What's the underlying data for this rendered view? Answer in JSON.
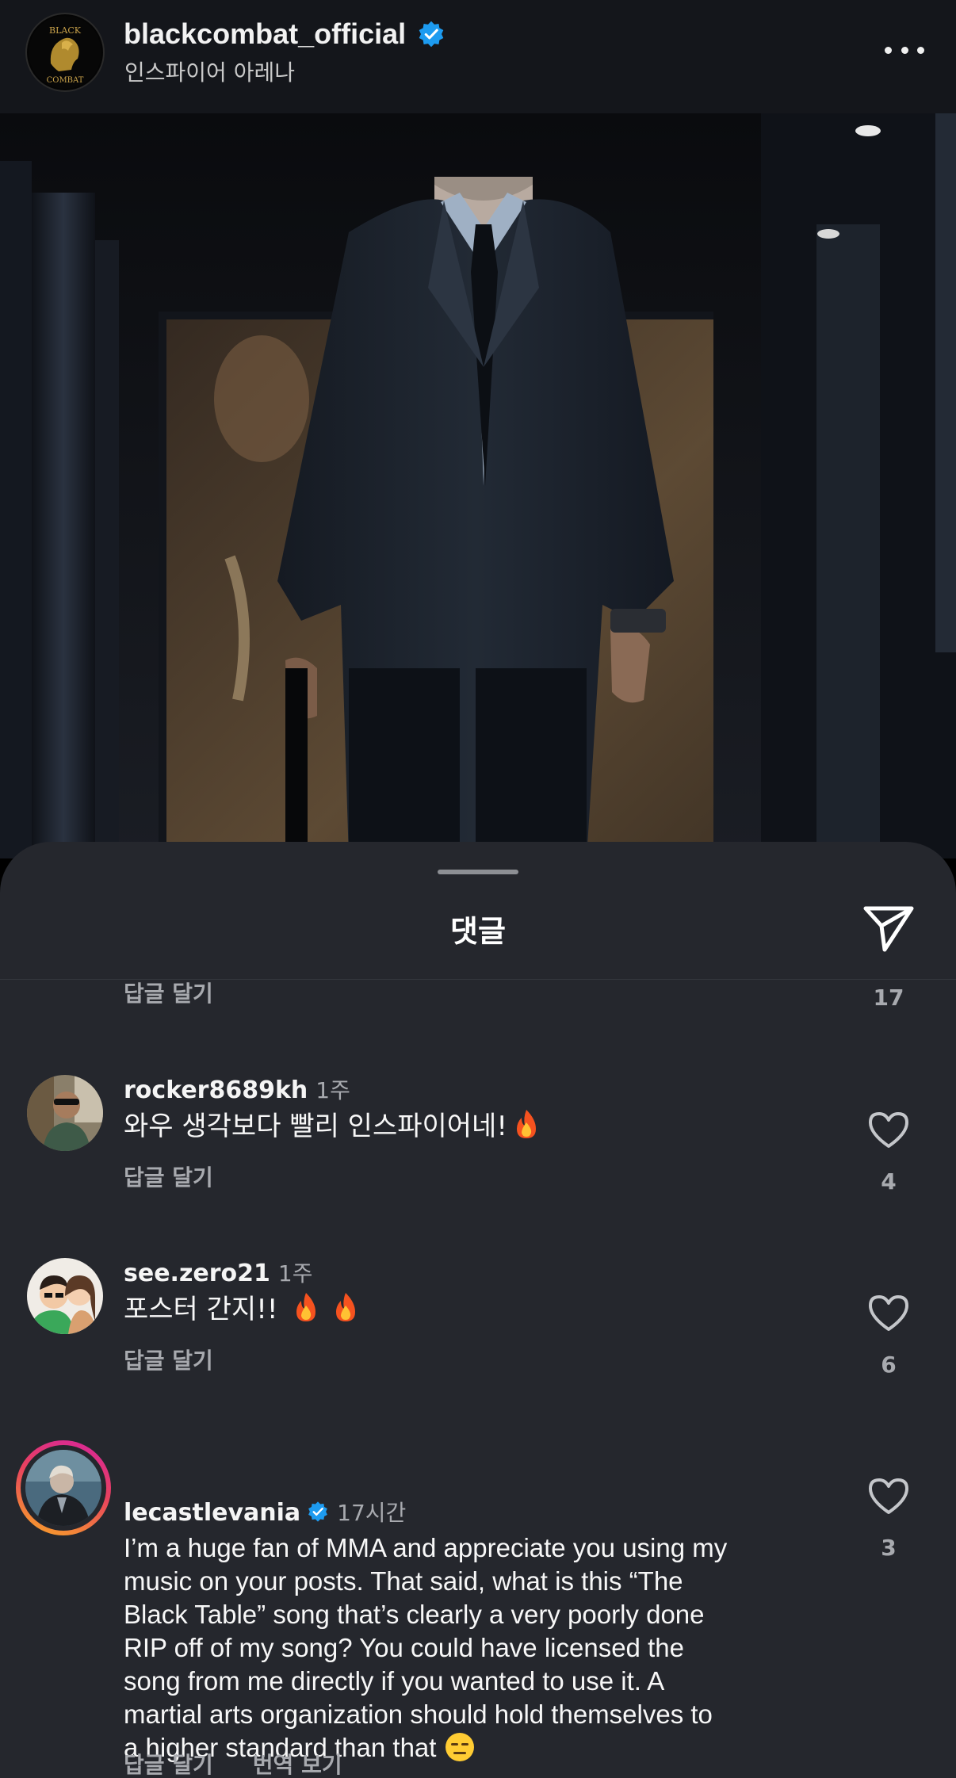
{
  "post": {
    "username": "blackcombat_official",
    "verified": true,
    "location": "인스파이어 아레나",
    "logo_text": [
      "BLACK",
      "COMBAT"
    ],
    "more_icon": "more-horizontal-icon"
  },
  "sheet": {
    "title": "댓글",
    "share_icon": "send-icon"
  },
  "previous_comment": {
    "reply_label": "답글 달기",
    "likes": "17"
  },
  "comments": [
    {
      "username": "rocker8689kh",
      "time": "1주",
      "text": "와우 생각보다 빨리 인스파이어네!",
      "emoji": [
        "fire"
      ],
      "reply_label": "답글 달기",
      "likes": "4"
    },
    {
      "username": "see.zero21",
      "time": "1주",
      "text": "포스터 간지!!",
      "emoji": [
        "fire",
        "fire"
      ],
      "reply_label": "답글 달기",
      "likes": "6"
    },
    {
      "username": "lecastlevania",
      "verified": true,
      "time": "17시간",
      "has_story_ring": true,
      "text_lines": [
        "I’m a huge fan of MMA and appreciate you using my",
        "music on your posts. That said, what is this “The",
        "Black Table” song that’s clearly a very poorly done",
        "RIP off of my song? You could have licensed the",
        "song from me directly if you wanted to use it. A",
        "martial arts organization should hold themselves to",
        "a higher standard than that"
      ],
      "emoji": [
        "expressionless-face"
      ],
      "reply_label": "답글 달기",
      "translate_label": "번역 보기",
      "likes": "3"
    }
  ],
  "colors": {
    "background": "#25272d",
    "header": "#14161b",
    "verified": "#1d9bf0",
    "secondary_text": "#a8aaaf",
    "story_ring_start": "#f9a825",
    "story_ring_end": "#d6249f"
  }
}
